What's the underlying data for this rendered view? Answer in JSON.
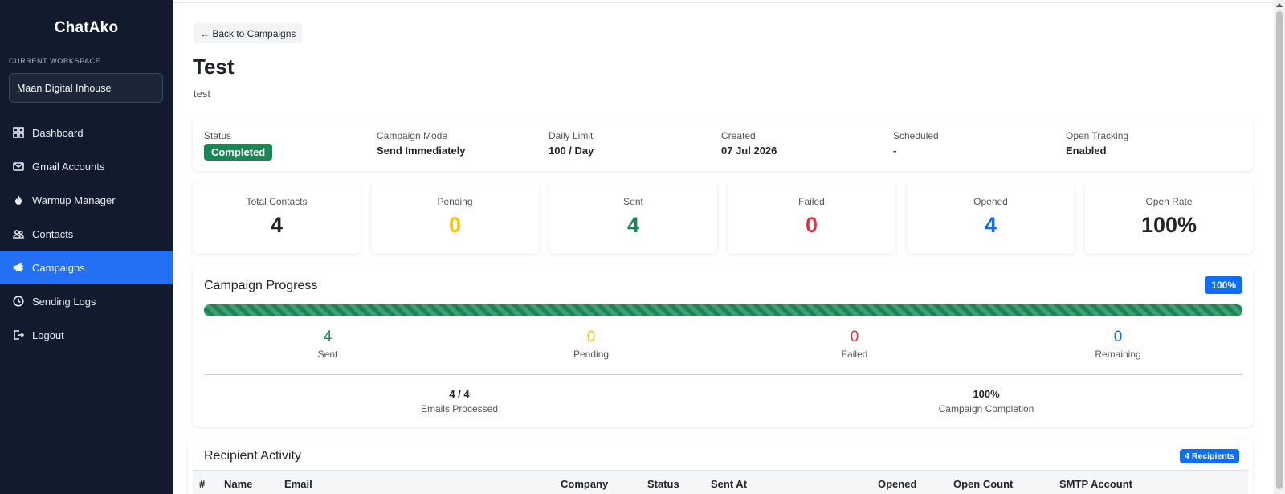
{
  "app": {
    "brand": "ChatAko"
  },
  "workspace": {
    "label": "CURRENT WORKSPACE",
    "current": "Maan Digital Inhouse"
  },
  "sidebar": {
    "items": [
      {
        "label": "Dashboard",
        "icon": "grid-icon",
        "active": false
      },
      {
        "label": "Gmail Accounts",
        "icon": "mail-icon",
        "active": false
      },
      {
        "label": "Warmup Manager",
        "icon": "fire-icon",
        "active": false
      },
      {
        "label": "Contacts",
        "icon": "people-icon",
        "active": false
      },
      {
        "label": "Campaigns",
        "icon": "megaphone-icon",
        "active": true
      },
      {
        "label": "Sending Logs",
        "icon": "clock-icon",
        "active": false
      },
      {
        "label": "Logout",
        "icon": "logout-icon",
        "active": false
      }
    ]
  },
  "back_button": "← Back to Campaigns",
  "campaign": {
    "title": "Test",
    "subtitle": "test",
    "info": {
      "status_label": "Status",
      "status_value": "Completed",
      "mode_label": "Campaign Mode",
      "mode_value": "Send Immediately",
      "limit_label": "Daily Limit",
      "limit_value": "100 / Day",
      "created_label": "Created",
      "created_value": "07 Jul 2026",
      "scheduled_label": "Scheduled",
      "scheduled_value": "-",
      "tracking_label": "Open Tracking",
      "tracking_value": "Enabled"
    }
  },
  "stats": [
    {
      "label": "Total Contacts",
      "value": "4",
      "color": "#212529"
    },
    {
      "label": "Pending",
      "value": "0",
      "color": "#ffc107"
    },
    {
      "label": "Sent",
      "value": "4",
      "color": "#198754"
    },
    {
      "label": "Failed",
      "value": "0",
      "color": "#dc3545"
    },
    {
      "label": "Opened",
      "value": "4",
      "color": "#0d6efd"
    },
    {
      "label": "Open Rate",
      "value": "100%",
      "color": "#212529"
    }
  ],
  "progress": {
    "title": "Campaign Progress",
    "percent_label": "100%",
    "percent": 100,
    "bar_color": "#198754",
    "breakdown": [
      {
        "value": "4",
        "label": "Sent",
        "color": "#198754"
      },
      {
        "value": "0",
        "label": "Pending",
        "color": "#ffc107"
      },
      {
        "value": "0",
        "label": "Failed",
        "color": "#dc3545"
      },
      {
        "value": "0",
        "label": "Remaining",
        "color": "#0d6efd"
      }
    ],
    "processed_value": "4 / 4",
    "processed_label": "Emails Processed",
    "completion_value": "100%",
    "completion_label": "Campaign Completion"
  },
  "recipients": {
    "title": "Recipient Activity",
    "badge": "4 Recipients",
    "columns": [
      "#",
      "Name",
      "Email",
      "Company",
      "Status",
      "Sent At",
      "Opened",
      "Open Count",
      "SMTP Account"
    ]
  }
}
